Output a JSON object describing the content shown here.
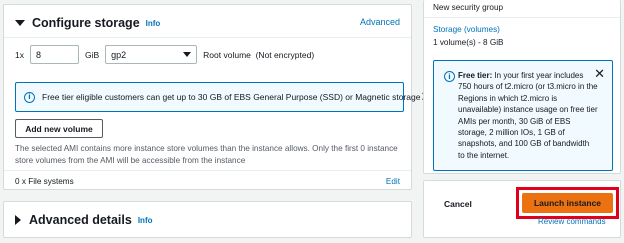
{
  "storage": {
    "title": "Configure storage",
    "info": "Info",
    "advanced_link": "Advanced",
    "multiplier": "1x",
    "size_value": "8",
    "size_unit": "GiB",
    "volume_type": "gp2",
    "volume_label": "Root volume  (Not encrypted)",
    "flash_message": "Free tier eligible customers can get up to 30 GB of EBS General Purpose (SSD) or Magnetic storage",
    "add_volume_label": "Add new volume",
    "note": "The selected AMI contains more instance store volumes than the instance allows. Only the first 0 instance store volumes from the AMI will be accessible from the instance",
    "file_systems": "0 x File systems",
    "edit_label": "Edit"
  },
  "advanced": {
    "title": "Advanced details",
    "info": "Info"
  },
  "summary": {
    "security_group": "New security group",
    "storage_link": "Storage (volumes)",
    "storage_value": "1 volume(s) - 8 GiB",
    "free_tier_heading": "Free tier:",
    "free_tier_body": " In your first year includes 750 hours of t2.micro (or t3.micro in the Regions in which t2.micro is unavailable) instance usage on free tier AMIs per month, 30 GiB of EBS storage, 2 million IOs, 1 GB of snapshots, and 100 GB of bandwidth to the internet."
  },
  "actions": {
    "cancel_label": "Cancel",
    "launch_label": "Launch instance",
    "review_label": "Review commands"
  },
  "colors": {
    "link": "#0073bb",
    "primary_button": "#ec7211",
    "highlight": "#e0001b",
    "info_bg": "#f1faff"
  }
}
